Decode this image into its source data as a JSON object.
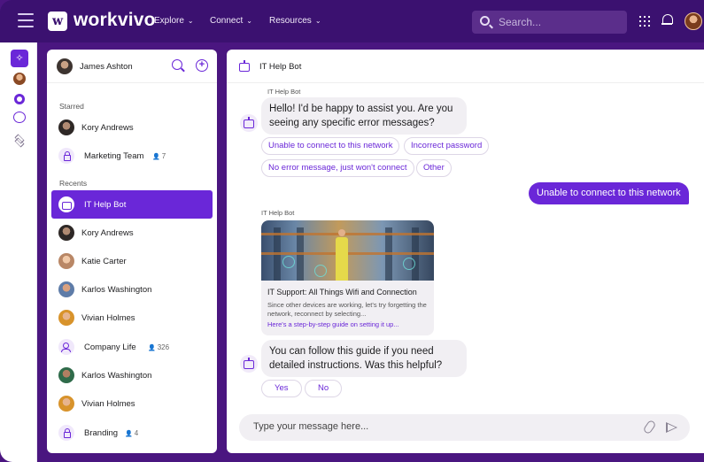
{
  "app": {
    "name": "workvivo",
    "logo_glyph": "w"
  },
  "topnav": {
    "items": [
      {
        "label": "Explore"
      },
      {
        "label": "Connect"
      },
      {
        "label": "Resources"
      }
    ],
    "search_placeholder": "Search..."
  },
  "sidebar": {
    "user_name": "James Ashton",
    "starred_label": "Starred",
    "recents_label": "Recents",
    "starred": [
      {
        "label": "Kory Andrews"
      },
      {
        "label": "Marketing Team",
        "count": "7"
      }
    ],
    "recents": [
      {
        "label": "IT Help Bot",
        "active": true
      },
      {
        "label": "Kory Andrews"
      },
      {
        "label": "Katie Carter"
      },
      {
        "label": "Karlos Washington"
      },
      {
        "label": "Vivian Holmes"
      },
      {
        "label": "Company Life",
        "count": "326"
      },
      {
        "label": "Karlos Washington"
      },
      {
        "label": "Vivian Holmes"
      },
      {
        "label": "Branding",
        "count": "4"
      }
    ]
  },
  "chat": {
    "title": "IT Help Bot",
    "bot_name": "IT Help Bot",
    "messages": {
      "greeting": "Hello! I'd be happy to assist you. Are you seeing any specific error messages?",
      "user_reply": "Unable to connect to this network",
      "followup": "You can follow this guide if you need detailed instructions. Was this helpful?"
    },
    "options": [
      "Unable to connect to this network",
      "Incorrect password",
      "No error message, just won't connect",
      "Other"
    ],
    "card": {
      "title": "IT Support: All Things Wifi and Connection",
      "desc": "Since other devices are working, let's try forgetting the network, reconnect by selecting...",
      "link": "Here's a step-by-step guide on setting it up..."
    },
    "feedback": [
      "Yes",
      "No"
    ],
    "composer_placeholder": "Type your message here..."
  },
  "colors": {
    "brand": "#3b1170",
    "accent": "#6a27d8"
  }
}
